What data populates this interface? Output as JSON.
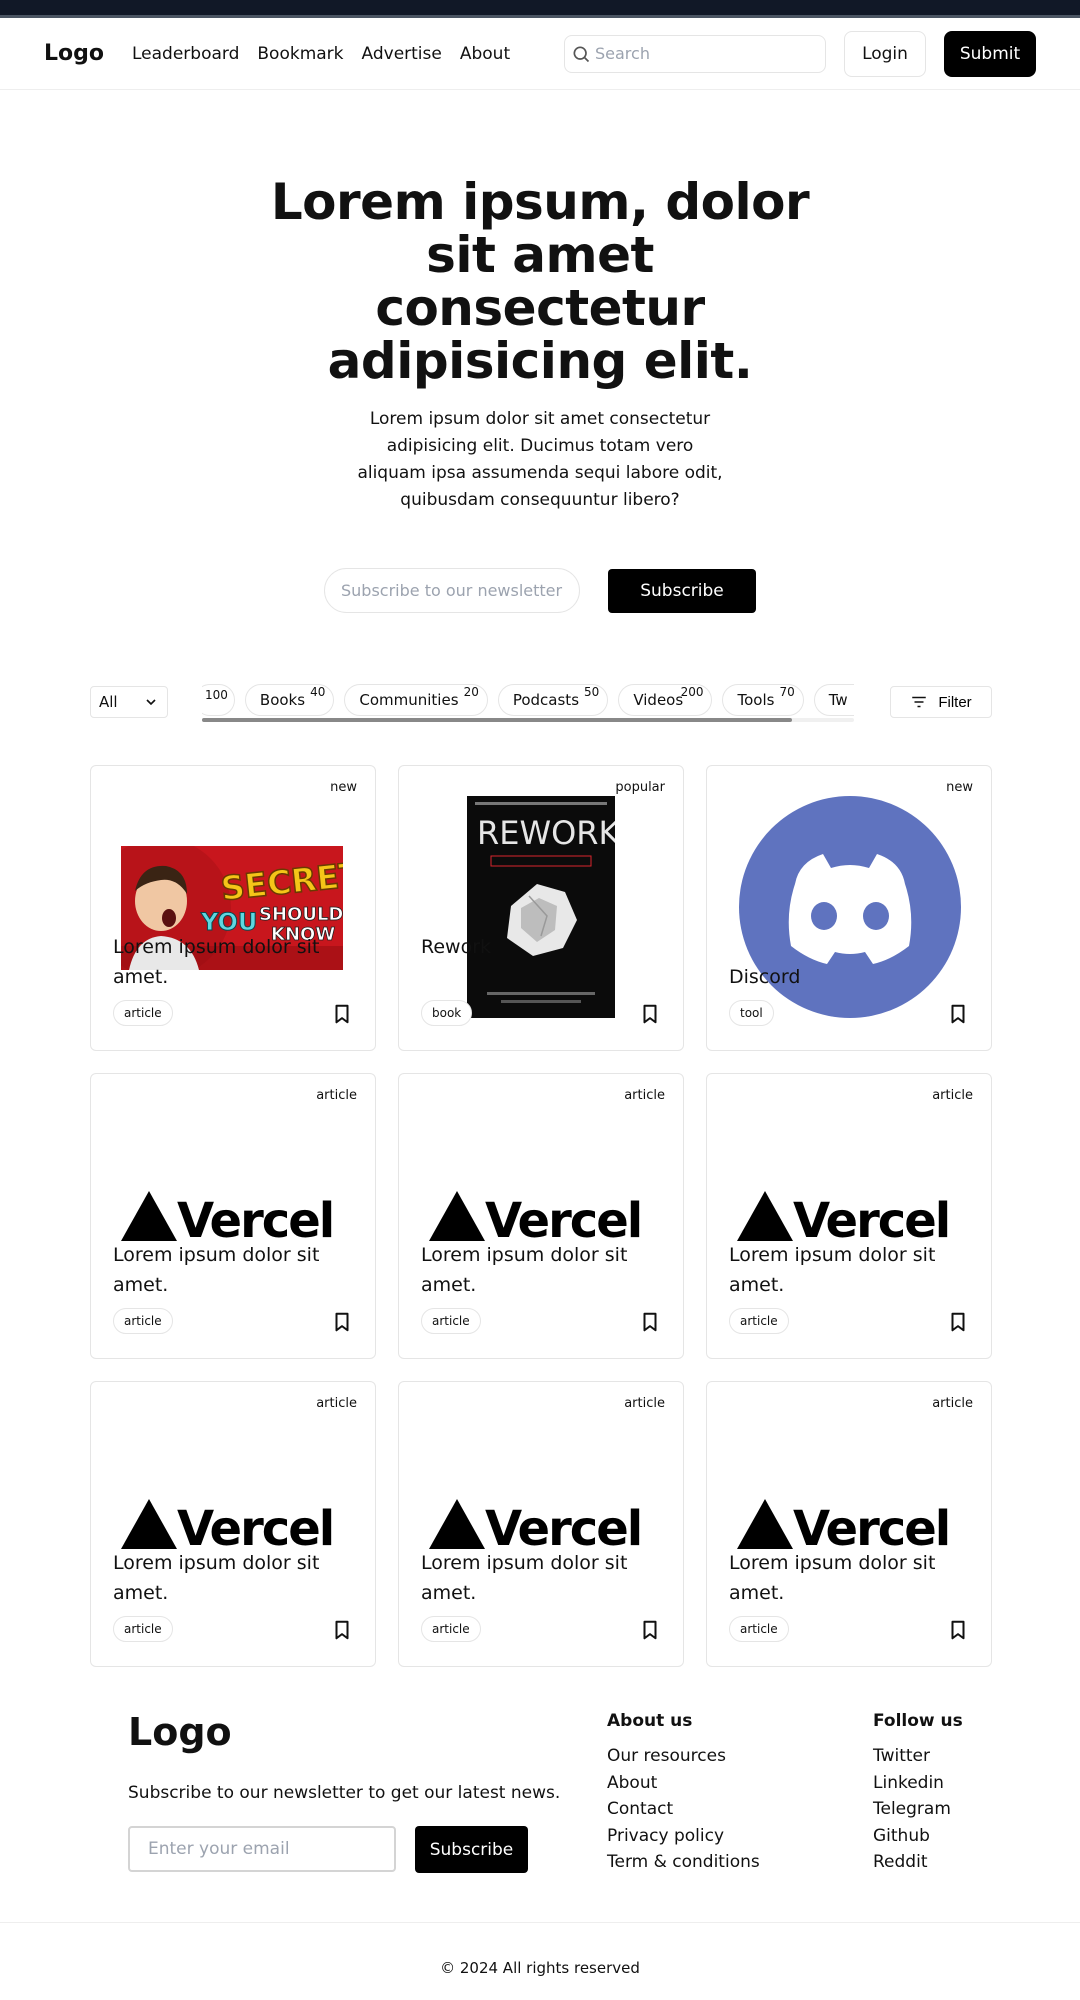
{
  "header": {
    "logo": "Logo",
    "nav": [
      "Leaderboard",
      "Bookmark",
      "Advertise",
      "About"
    ],
    "search_placeholder": "Search",
    "login_label": "Login",
    "submit_label": "Submit"
  },
  "hero": {
    "title": "Lorem ipsum, dolor sit amet consectetur adipisicing elit.",
    "subtitle": "Lorem ipsum dolor sit amet consectetur adipisicing elit. Ducimus totam vero aliquam ipsa assumenda sequi labore odit, quibusdam consequuntur libero?",
    "newsletter_placeholder": "Subscribe to our newsletter",
    "subscribe_label": "Subscribe"
  },
  "filters": {
    "selected": "All",
    "chips": [
      {
        "label": "",
        "count": "100"
      },
      {
        "label": "Books",
        "count": "40"
      },
      {
        "label": "Communities",
        "count": "20"
      },
      {
        "label": "Podcasts",
        "count": "50"
      },
      {
        "label": "Videos",
        "count": "200"
      },
      {
        "label": "Tools",
        "count": "70"
      },
      {
        "label": "Tw",
        "count": ""
      }
    ],
    "filter_label": "Filter"
  },
  "cards": [
    {
      "corner": "new",
      "title": "Lorem ipsum dolor sit amet.",
      "badge": "article",
      "image": "secrets-video-thumbnail",
      "image_text": [
        "SECRETS",
        "YOU",
        "SHOULD",
        "KNOW"
      ]
    },
    {
      "corner": "popular",
      "title": "Rework",
      "badge": "book",
      "image": "rework-book-cover",
      "image_text": [
        "REWORK"
      ]
    },
    {
      "corner": "new",
      "title": "Discord",
      "badge": "tool",
      "image": "discord-logo"
    },
    {
      "corner": "article",
      "title": "Lorem ipsum dolor sit amet.",
      "badge": "article",
      "image": "vercel-logo",
      "image_text": [
        "Vercel"
      ]
    },
    {
      "corner": "article",
      "title": "Lorem ipsum dolor sit amet.",
      "badge": "article",
      "image": "vercel-logo",
      "image_text": [
        "Vercel"
      ]
    },
    {
      "corner": "article",
      "title": "Lorem ipsum dolor sit amet.",
      "badge": "article",
      "image": "vercel-logo",
      "image_text": [
        "Vercel"
      ]
    },
    {
      "corner": "article",
      "title": "Lorem ipsum dolor sit amet.",
      "badge": "article",
      "image": "vercel-logo",
      "image_text": [
        "Vercel"
      ]
    },
    {
      "corner": "article",
      "title": "Lorem ipsum dolor sit amet.",
      "badge": "article",
      "image": "vercel-logo",
      "image_text": [
        "Vercel"
      ]
    },
    {
      "corner": "article",
      "title": "Lorem ipsum dolor sit amet.",
      "badge": "article",
      "image": "vercel-logo",
      "image_text": [
        "Vercel"
      ]
    }
  ],
  "footer": {
    "logo": "Logo",
    "newsletter_text": "Subscribe to our newsletter to get our latest news.",
    "email_placeholder": "Enter your email",
    "subscribe_label": "Subscribe",
    "about_heading": "About us",
    "about_links": [
      "Our resources",
      "About",
      "Contact",
      "Privacy policy",
      "Term & conditions"
    ],
    "follow_heading": "Follow us",
    "follow_links": [
      "Twitter",
      "Linkedin",
      "Telegram",
      "Github",
      "Reddit"
    ],
    "copyright": "© 2024 All rights reserved"
  },
  "colors": {
    "topbar": "#111827",
    "primary_button": "#000000",
    "discord_blurple": "#5f73bf",
    "secrets_red": "#c8161d",
    "secrets_yellow": "#f5c518",
    "rework_red": "#d9262c"
  }
}
